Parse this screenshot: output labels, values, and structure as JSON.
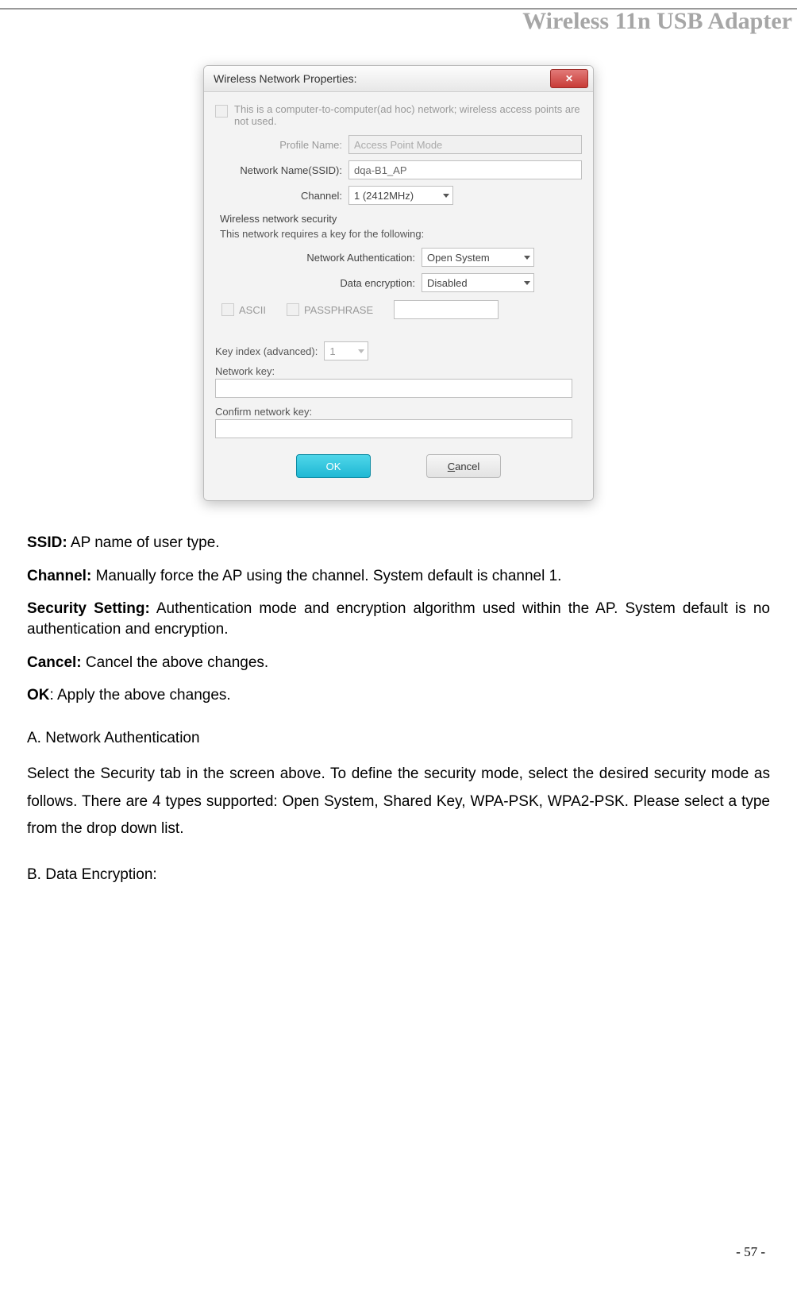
{
  "header": {
    "title": "Wireless 11n USB Adapter"
  },
  "dialog": {
    "title": "Wireless Network Properties:",
    "adhoc_text": "This is a computer-to-computer(ad hoc) network; wireless access points are not used.",
    "profile_name_label": "Profile Name:",
    "profile_name_value": "Access Point Mode",
    "ssid_label": "Network Name(SSID):",
    "ssid_value": "dqa-B1_AP",
    "channel_label": "Channel:",
    "channel_value": "1 (2412MHz)",
    "security_section": "Wireless network security",
    "security_hint": "This network requires a key for the following:",
    "auth_label": "Network Authentication:",
    "auth_value": "Open System",
    "encryption_label": "Data encryption:",
    "encryption_value": "Disabled",
    "ascii_label": "ASCII",
    "passphrase_label": "PASSPHRASE",
    "key_index_label": "Key index (advanced):",
    "key_index_value": "1",
    "network_key_label": "Network key:",
    "confirm_key_label": "Confirm network key:",
    "ok_label": "OK",
    "cancel_letter": "C",
    "cancel_rest": "ancel"
  },
  "doc": {
    "ssid_b": "SSID:",
    "ssid_t": "AP name of user type.",
    "channel_b": "Channel:",
    "channel_t": "Manually force the AP using the channel. System default is channel 1.",
    "security_b": "Security Setting:",
    "security_t": "Authentication mode and encryption algorithm used within the AP. System default is no authentication and encryption.",
    "cancel_b": "Cancel:",
    "cancel_t": "Cancel the above changes.",
    "ok_b": "OK",
    "ok_t": ": Apply the above changes.",
    "section_a": "A. Network Authentication",
    "section_a_text": "Select the Security tab in the screen above. To define the security mode, select the desired security mode as follows. There are 4 types supported: Open System, Shared Key, WPA-PSK, WPA2-PSK. Please select a type from the drop down list.",
    "section_b": "B. Data Encryption:"
  },
  "footer": {
    "page_num": "- 57 -"
  }
}
